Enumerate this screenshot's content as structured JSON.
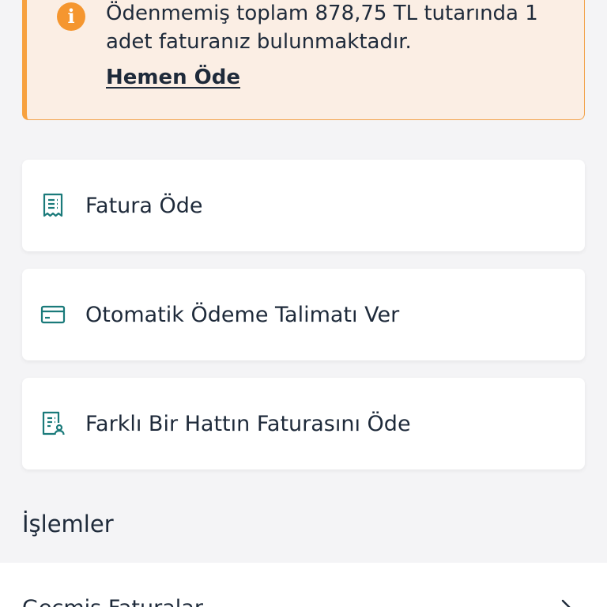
{
  "alert": {
    "icon": "info-icon",
    "icon_glyph": "i",
    "message": "Ödenmemiş toplam 878,75 TL tutarında 1 adet faturanız bulunmaktadır.",
    "action_label": "Hemen Öde",
    "accent_color": "#f7a13f",
    "background_color": "#fbeee4"
  },
  "actions": [
    {
      "label": "Fatura Öde",
      "icon": "receipt-icon"
    },
    {
      "label": "Otomatik Ödeme Talimatı Ver",
      "icon": "credit-card-icon"
    },
    {
      "label": "Farklı Bir Hattın Faturasını Öde",
      "icon": "user-document-icon"
    }
  ],
  "icon_color": "#1a7a7a",
  "section": {
    "title": "İşlemler"
  },
  "list": [
    {
      "label": "Geçmiş Faturalar",
      "icon": "chevron-right-icon"
    }
  ]
}
